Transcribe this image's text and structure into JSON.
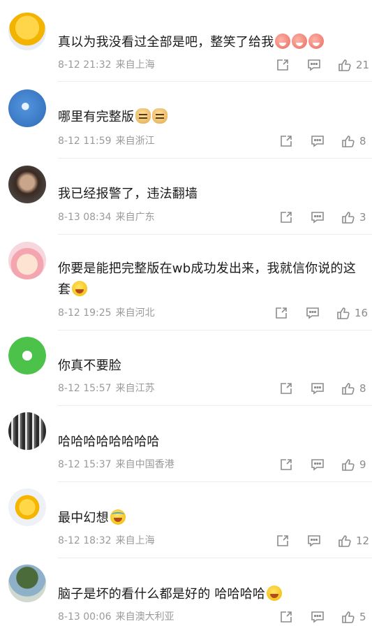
{
  "comments": [
    {
      "text": "真以为我没看过全部是吧，整笑了给我",
      "emojis": [
        "peach",
        "peach",
        "peach"
      ],
      "date": "8-12 21:32",
      "location": "来自上海",
      "likes": "21"
    },
    {
      "text": "哪里有完整版",
      "emojis": [
        "doge",
        "doge"
      ],
      "date": "8-12 11:59",
      "location": "来自浙江",
      "likes": "8"
    },
    {
      "text": "我已经报警了，违法翻墙",
      "emojis": [],
      "date": "8-13 08:34",
      "location": "来自广东",
      "likes": "3"
    },
    {
      "text": "你要是能把完整版在wb成功发出来，我就信你说的这套",
      "emojis": [
        "laugh"
      ],
      "date": "8-12 19:25",
      "location": "来自河北",
      "likes": "16"
    },
    {
      "text": "你真不要脸",
      "emojis": [],
      "date": "8-12 15:57",
      "location": "来自江苏",
      "likes": "8"
    },
    {
      "text": "哈哈哈哈哈哈哈哈",
      "emojis": [],
      "date": "8-12 15:37",
      "location": "来自中国香港",
      "likes": "9"
    },
    {
      "text": "最中幻想",
      "emojis": [
        "cry"
      ],
      "date": "8-12 18:32",
      "location": "来自上海",
      "likes": "12"
    },
    {
      "text": "脑子是坏的看什么都是好的 哈哈哈哈",
      "emojis": [
        "laugh"
      ],
      "date": "8-13 00:06",
      "location": "来自澳大利亚",
      "likes": "5"
    }
  ],
  "colors": {
    "meta": "#9a9a9a",
    "icon": "#8c8c8c",
    "divider": "#ececec"
  },
  "icons": {
    "forward": "share-icon",
    "comment": "comment-icon",
    "like": "thumb-up-icon"
  }
}
